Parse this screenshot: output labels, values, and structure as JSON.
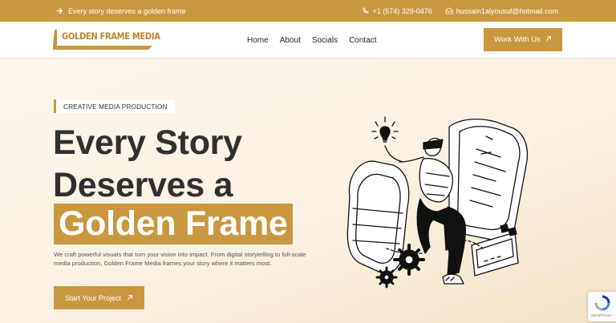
{
  "topbar": {
    "tagline": "Every story deserves a golden frame",
    "phone": "+1 (574) 329-0476",
    "email": "hussain1alyousuf@hotmail.com",
    "icons": [
      "arrow-right-icon",
      "phone-icon",
      "mail-icon"
    ]
  },
  "brand": {
    "name": "GOLDEN FRAME MEDIA"
  },
  "nav": {
    "items": [
      "Home",
      "About",
      "Socials",
      "Contact"
    ],
    "cta": "Work With Us"
  },
  "hero": {
    "eyebrow": "CREATIVE MEDIA PRODUCTION",
    "headline": [
      "Every Story",
      "Deserves a",
      "Golden Frame"
    ],
    "description": "We craft powerful visuals that turn your vision into impact. From digital storytelling to full-scale media production, Golden Frame Media frames your story where it matters most.",
    "cta": "Start Your Project"
  },
  "recaptcha": {
    "label": "reCAPTCHA"
  },
  "colors": {
    "accent": "#c9973f",
    "text": "#303030",
    "background": "#fdf6ec"
  }
}
